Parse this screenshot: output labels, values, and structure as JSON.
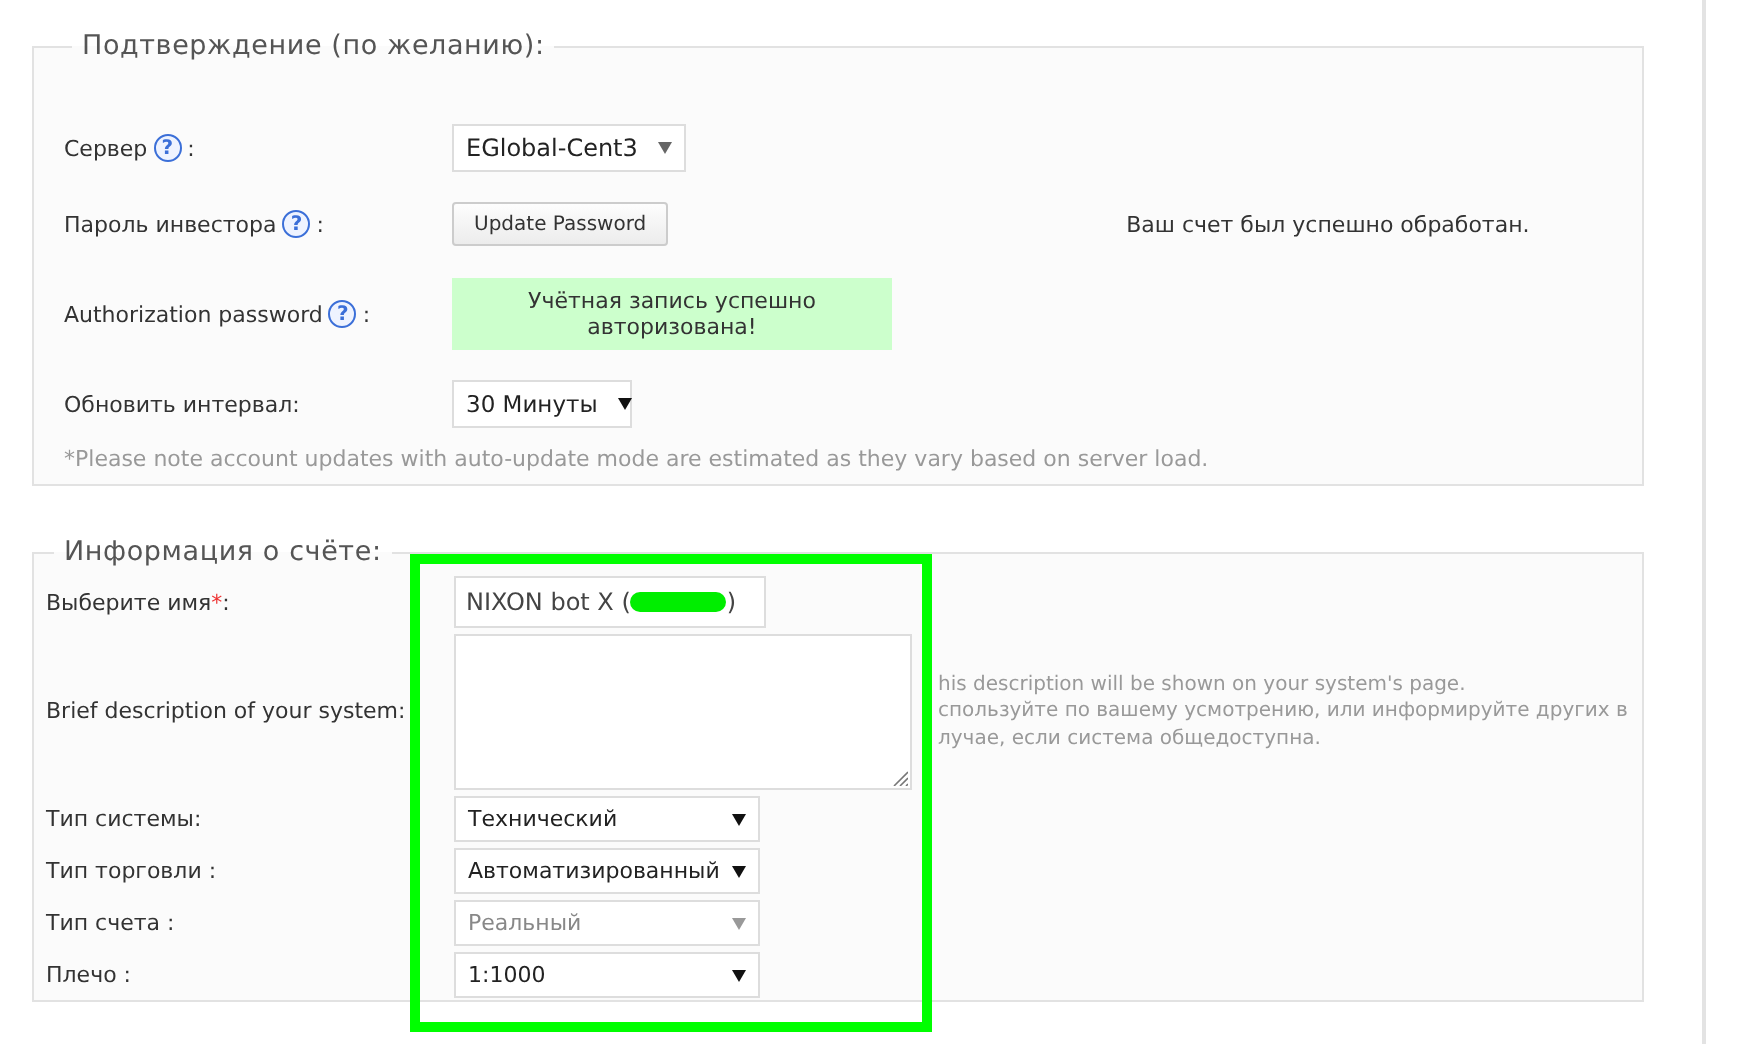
{
  "confirmation": {
    "legend": "Подтверждение (по желанию):",
    "server": {
      "label": "Сервер",
      "help": "?",
      "suffix": ":",
      "value": "EGlobal-Cent3"
    },
    "investor_password": {
      "label": "Пароль инвестора",
      "help": "?",
      "suffix": ":",
      "button": "Update Password",
      "message": "Ваш счет был успешно обработан."
    },
    "authorization": {
      "label": "Authorization password",
      "help": "?",
      "suffix": ":",
      "status": "Учётная запись успешно авторизована!"
    },
    "interval": {
      "label": "Обновить интервал:",
      "value": "30 Минуты"
    },
    "note": "*Please note account updates with auto-update mode are estimated as they vary based on server load."
  },
  "account_info": {
    "legend": "Информация о счёте:",
    "name": {
      "label": "Выберите имя",
      "required_mark": "*",
      "suffix": ":",
      "value_start": "NIXON bot X (",
      "value_end": ")",
      "redacted": true
    },
    "description": {
      "label": "Brief description of your system:",
      "hint_lines": [
        "his description will be shown on your system's page.",
        "спользуйте по вашему усмотрению, или информируйте других в",
        "лучае, если система общедоступна."
      ]
    },
    "selects": [
      {
        "label": "Тип системы:",
        "value": "Технический",
        "disabled": false
      },
      {
        "label": "Тип торговли :",
        "value": "Автоматизированный",
        "disabled": false
      },
      {
        "label": "Тип счета :",
        "value": "Реальный",
        "disabled": true
      },
      {
        "label": "Плечо :",
        "value": "1:1000",
        "disabled": false
      }
    ],
    "highlighted": true
  }
}
